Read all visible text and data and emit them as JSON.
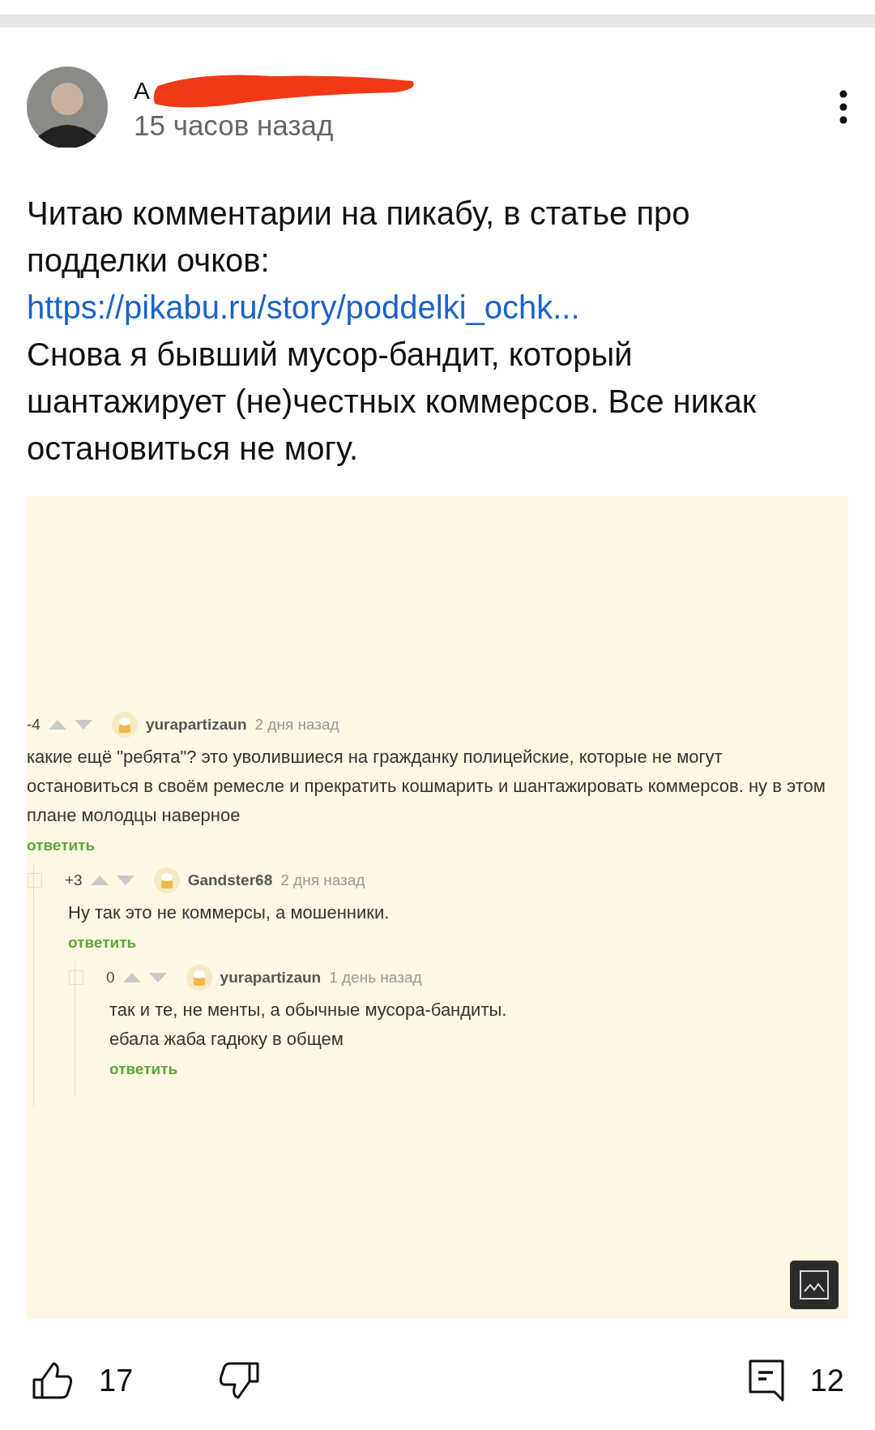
{
  "post": {
    "author": "А",
    "time": "15 часов назад",
    "paragraphs": [
      {
        "kind": "text",
        "text": "Читаю комментарии на пикабу, в статье про подделки очков:"
      },
      {
        "kind": "link",
        "text": "https://pikabu.ru/story/poddelki_ochk..."
      },
      {
        "kind": "text",
        "text": "Снова я бывший мусор-бандит, который шантажирует (не)честных коммерсов. Все никак остановиться не могу."
      }
    ]
  },
  "embedded_comments": [
    {
      "score": "-4",
      "author": "yurapartizaun",
      "time": "2 дня назад",
      "lines": [
        "какие ещё \"ребята\"? это уволившиеся на гражданку полицейские, которые не могут остановиться в своём ремесле и прекратить кошмарить и шантажировать коммерсов. ну в этом плане молодцы наверное"
      ],
      "reply": "ответить",
      "children": [
        {
          "score": "+3",
          "author": "Gandster68",
          "time": "2 дня назад",
          "lines": [
            "Ну так это не коммерсы, а мошенники."
          ],
          "reply": "ответить",
          "children": [
            {
              "score": "0",
              "author": "yurapartizaun",
              "time": "1 день назад",
              "lines": [
                "так и те, не менты, а обычные мусора-бандиты.",
                "ебала жаба гадюку в общем"
              ],
              "reply": "ответить"
            }
          ]
        }
      ]
    }
  ],
  "actions": {
    "likes": "17",
    "comments": "12"
  }
}
